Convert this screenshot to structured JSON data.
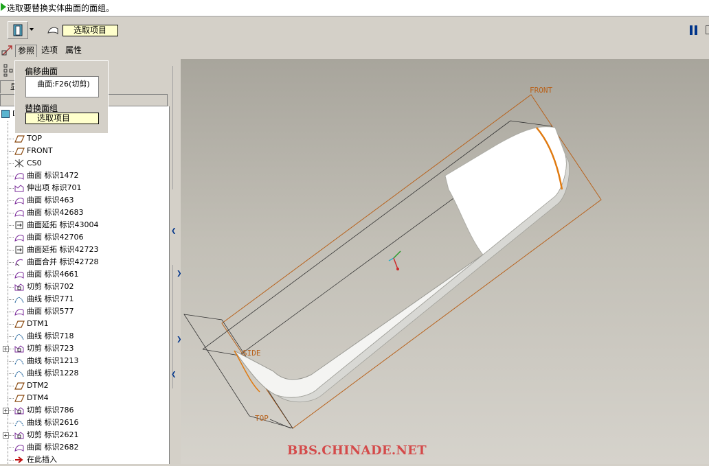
{
  "message": {
    "text": "选取要替换实体曲面的面组。"
  },
  "dashboard": {
    "collector_value": "选取项目"
  },
  "tabs": [
    {
      "label": "参照"
    },
    {
      "label": "选项"
    },
    {
      "label": "属性"
    }
  ],
  "popup": {
    "offset_surface_label": "偏移曲面",
    "offset_surface_item": "曲面:F26(切剪)",
    "replace_quilt_label": "替换面组",
    "replace_quilt_value": "选取项目"
  },
  "panel": {
    "small_tab_label": "显"
  },
  "tree": {
    "root_label": "D",
    "items": [
      {
        "label": "TOP",
        "icon": "datum-plane-icon"
      },
      {
        "label": "FRONT",
        "icon": "datum-plane-icon"
      },
      {
        "label": "CS0",
        "icon": "coordinate-system-icon"
      },
      {
        "label": "曲面 标识1472",
        "icon": "surface-icon"
      },
      {
        "label": "伸出项 标识701",
        "icon": "protrusion-icon"
      },
      {
        "label": "曲面 标识463",
        "icon": "surface-icon"
      },
      {
        "label": "曲面 标识42683",
        "icon": "surface-icon"
      },
      {
        "label": "曲面延拓 标识43004",
        "icon": "surface-extend-icon"
      },
      {
        "label": "曲面 标识42706",
        "icon": "surface-icon"
      },
      {
        "label": "曲面延拓 标识42723",
        "icon": "surface-extend-icon"
      },
      {
        "label": "曲面合并 标识42728",
        "icon": "surface-merge-icon"
      },
      {
        "label": "曲面 标识4661",
        "icon": "surface-icon"
      },
      {
        "label": "切剪 标识702",
        "icon": "cut-icon"
      },
      {
        "label": "曲线 标识771",
        "icon": "curve-icon"
      },
      {
        "label": "曲面 标识577",
        "icon": "surface-icon"
      },
      {
        "label": "DTM1",
        "icon": "datum-plane-icon"
      },
      {
        "label": "曲线 标识718",
        "icon": "curve-icon"
      },
      {
        "label": "切剪 标识723",
        "icon": "cut-icon"
      },
      {
        "label": "曲线 标识1213",
        "icon": "curve-icon"
      },
      {
        "label": "曲线 标识1228",
        "icon": "curve-icon"
      },
      {
        "label": "DTM2",
        "icon": "datum-plane-icon"
      },
      {
        "label": "DTM4",
        "icon": "datum-plane-icon"
      },
      {
        "label": "切剪 标识786",
        "icon": "cut-icon"
      },
      {
        "label": "曲线 标识2616",
        "icon": "curve-icon"
      },
      {
        "label": "切剪 标识2621",
        "icon": "cut-icon"
      },
      {
        "label": "曲面 标识2682",
        "icon": "surface-icon"
      },
      {
        "label": "在此插入",
        "icon": "insert-here-icon"
      }
    ]
  },
  "graphics": {
    "datum_labels": [
      "FRONT",
      "SIDE",
      "TOP"
    ],
    "watermark": "BBS.CHINADE.NET"
  },
  "colors": {
    "collector_bg": "#ffffcc",
    "datum_orange": "#b8621c",
    "watermark_red": "#d44a4a"
  }
}
